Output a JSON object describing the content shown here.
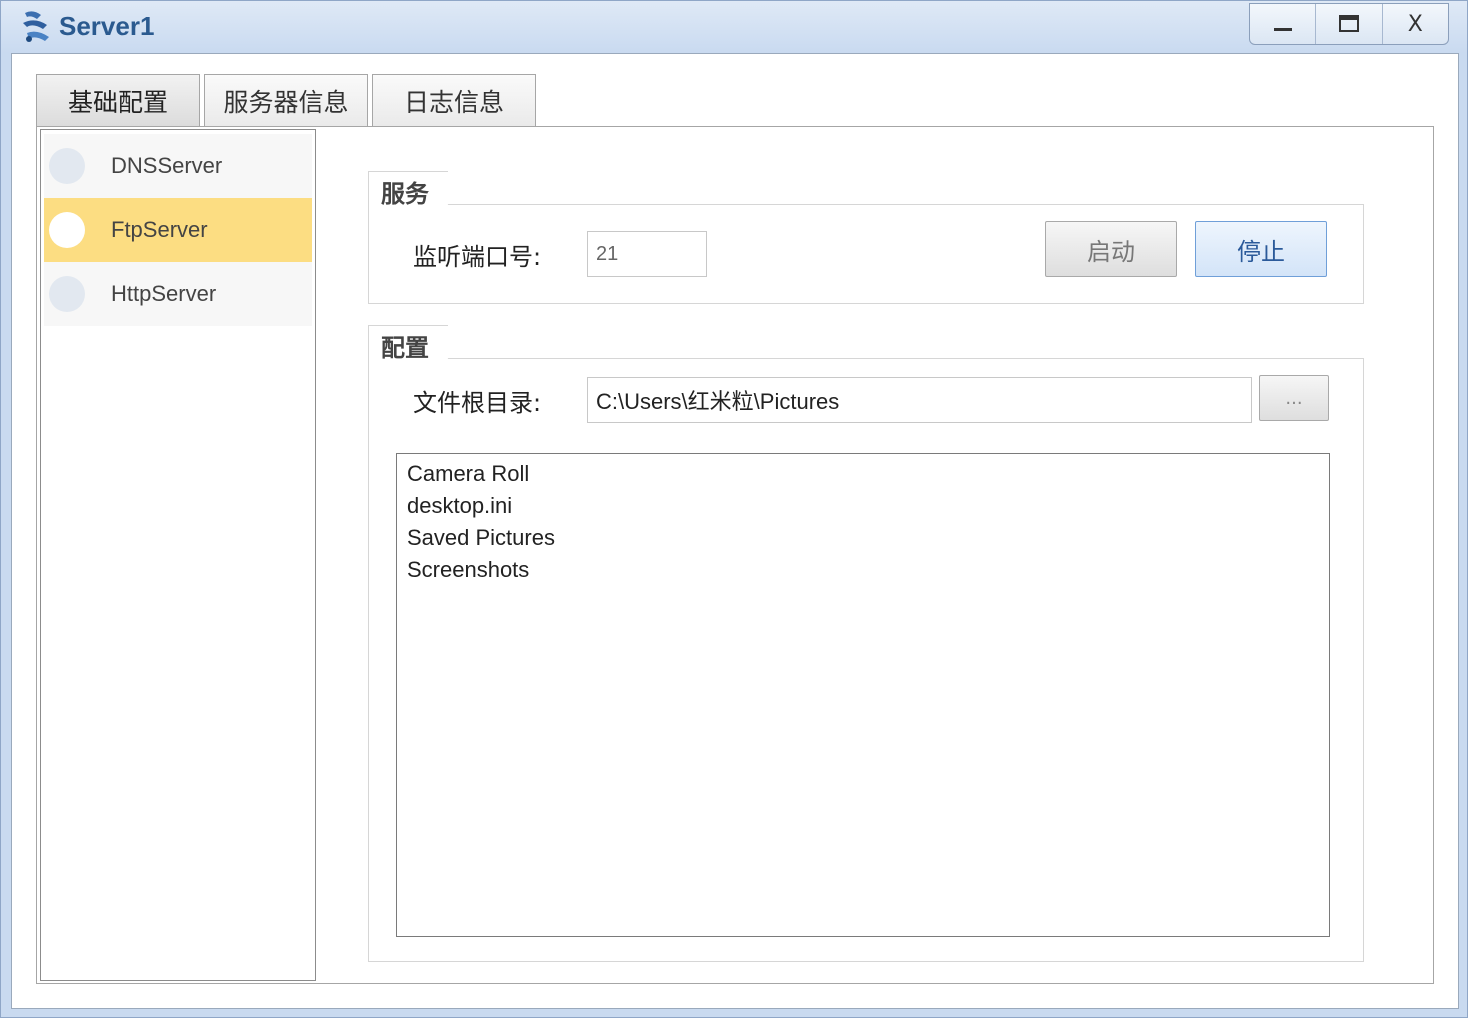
{
  "window": {
    "title": "Server1",
    "controls": {
      "minimize": "—",
      "maximize": "☐",
      "close": "X"
    }
  },
  "tabs": [
    {
      "label": "基础配置",
      "active": true
    },
    {
      "label": "服务器信息",
      "active": false
    },
    {
      "label": "日志信息",
      "active": false
    }
  ],
  "servers": [
    {
      "label": "DNSServer",
      "selected": false
    },
    {
      "label": "FtpServer",
      "selected": true
    },
    {
      "label": "HttpServer",
      "selected": false
    }
  ],
  "service": {
    "group_title": "服务",
    "port_label": "监听端口号:",
    "port_value": "21",
    "start_label": "启动",
    "stop_label": "停止"
  },
  "config": {
    "group_title": "配置",
    "root_label": "文件根目录:",
    "root_value": "C:\\Users\\红米粒\\Pictures",
    "browse_label": "...",
    "files": [
      "Camera Roll",
      "desktop.ini",
      "Saved Pictures",
      "Screenshots"
    ]
  },
  "colors": {
    "selected_item": "#fcdd82",
    "title_text": "#2b5a8f",
    "primary_button_text": "#2b5a9a"
  }
}
